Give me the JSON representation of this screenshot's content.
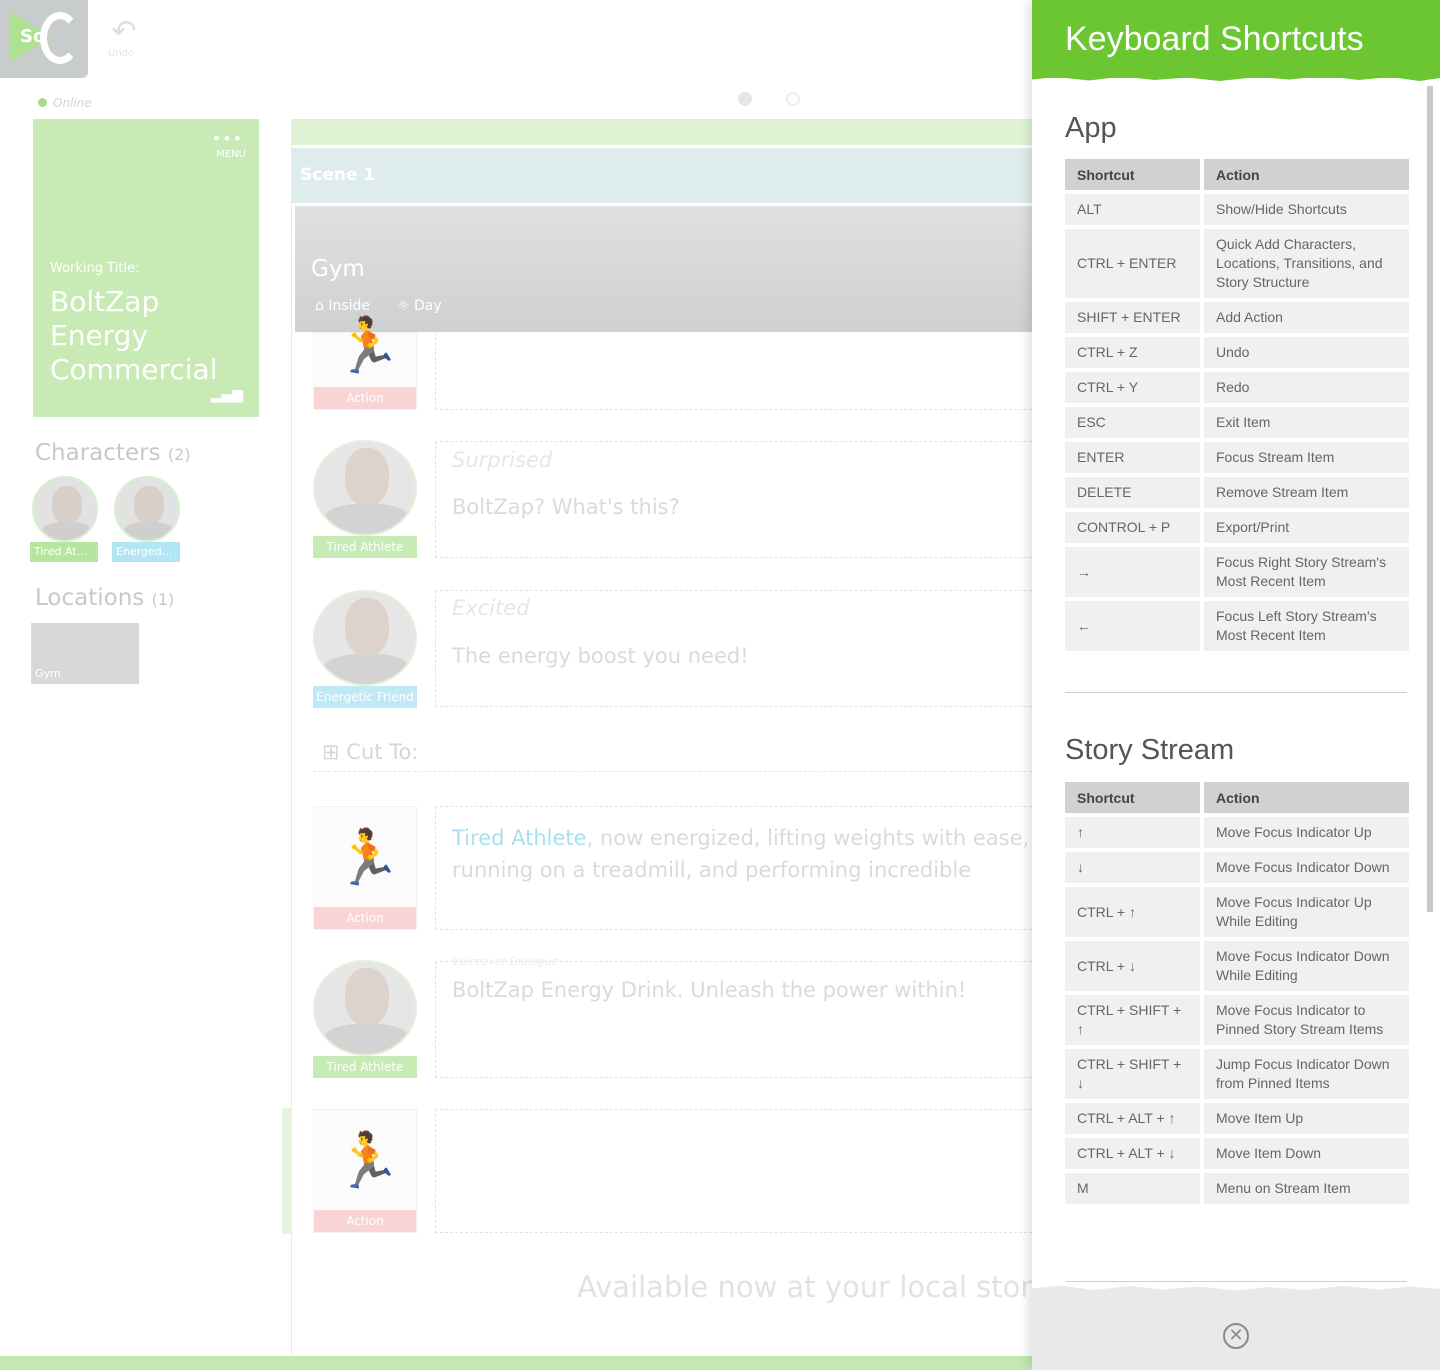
{
  "app": {
    "logo_text": "So",
    "undo_label": "Undo",
    "online_status": "Online",
    "menu_label": "MENU",
    "working_title_label": "Working Title:",
    "working_title": "BoltZap Energy Commercial",
    "characters_heading": "Characters",
    "characters_count": "(2)",
    "characters": [
      {
        "tag": "Tired At...",
        "color": "#b5e59e"
      },
      {
        "tag": "Energed...",
        "color": "#b2e6f4"
      }
    ],
    "locations_heading": "Locations",
    "locations_count": "(1)",
    "locations": [
      {
        "name": "Gym"
      }
    ]
  },
  "stream": {
    "scene_title": "Scene 1",
    "location_name": "Gym",
    "location_inside": "Inside",
    "location_time": "Day",
    "items": {
      "action1_tag": "Action",
      "dialog1_character": "Tired Athlete",
      "dialog1_parenthetical": "Surprised",
      "dialog1_text": "BoltZap? What's this?",
      "dialog2_character": "Energetic Friend",
      "dialog2_parenthetical": "Excited",
      "dialog2_text": "The energy boost you need!",
      "transition": "Cut To:",
      "action2_tag": "Action",
      "action2_highlight": "Tired Athlete",
      "action2_text": ", now energized, lifting weights with ease, running on a treadmill, and performing incredible athletic feats.",
      "vo_label": "Voiceover Dialogue",
      "dialog3_character": "Tired Athlete",
      "dialog3_text": "BoltZap Energy Drink. Unleash the power within!",
      "action3_tag": "Action",
      "tagline": "Available now at your local store"
    }
  },
  "shortcuts_panel": {
    "title": "Keyboard Shortcuts",
    "header_shortcut": "Shortcut",
    "header_action": "Action",
    "accent_color": "#6cc631",
    "sections": [
      {
        "title": "App",
        "rows": [
          {
            "shortcut": "ALT",
            "action": "Show/Hide Shortcuts"
          },
          {
            "shortcut": "CTRL + ENTER",
            "action": "Quick Add Characters, Locations, Transitions, and Story Structure"
          },
          {
            "shortcut": "SHIFT + ENTER",
            "action": "Add Action"
          },
          {
            "shortcut": "CTRL + Z",
            "action": "Undo"
          },
          {
            "shortcut": "CTRL + Y",
            "action": "Redo"
          },
          {
            "shortcut": "ESC",
            "action": "Exit Item"
          },
          {
            "shortcut": "ENTER",
            "action": "Focus Stream Item"
          },
          {
            "shortcut": "DELETE",
            "action": "Remove Stream Item"
          },
          {
            "shortcut": "CONTROL + P",
            "action": "Export/Print"
          },
          {
            "shortcut": "→",
            "action": "Focus Right Story Stream's Most Recent Item"
          },
          {
            "shortcut": "←",
            "action": "Focus Left Story Stream's Most Recent Item"
          }
        ]
      },
      {
        "title": "Story Stream",
        "rows": [
          {
            "shortcut": "↑",
            "action": "Move Focus Indicator Up"
          },
          {
            "shortcut": "↓",
            "action": "Move Focus Indicator Down"
          },
          {
            "shortcut": "CTRL + ↑",
            "action": "Move Focus Indicator Up While Editing"
          },
          {
            "shortcut": "CTRL + ↓",
            "action": "Move Focus Indicator Down While Editing"
          },
          {
            "shortcut": "CTRL + SHIFT + ↑",
            "action": "Move Focus Indicator to Pinned Story Stream Items"
          },
          {
            "shortcut": "CTRL + SHIFT + ↓",
            "action": "Jump Focus Indicator Down from Pinned Items"
          },
          {
            "shortcut": "CTRL + ALT + ↑",
            "action": "Move Item Up"
          },
          {
            "shortcut": "CTRL + ALT + ↓",
            "action": "Move Item Down"
          },
          {
            "shortcut": "M",
            "action": "Menu on Stream Item"
          }
        ]
      }
    ],
    "close_icon": "close-circle-icon"
  }
}
